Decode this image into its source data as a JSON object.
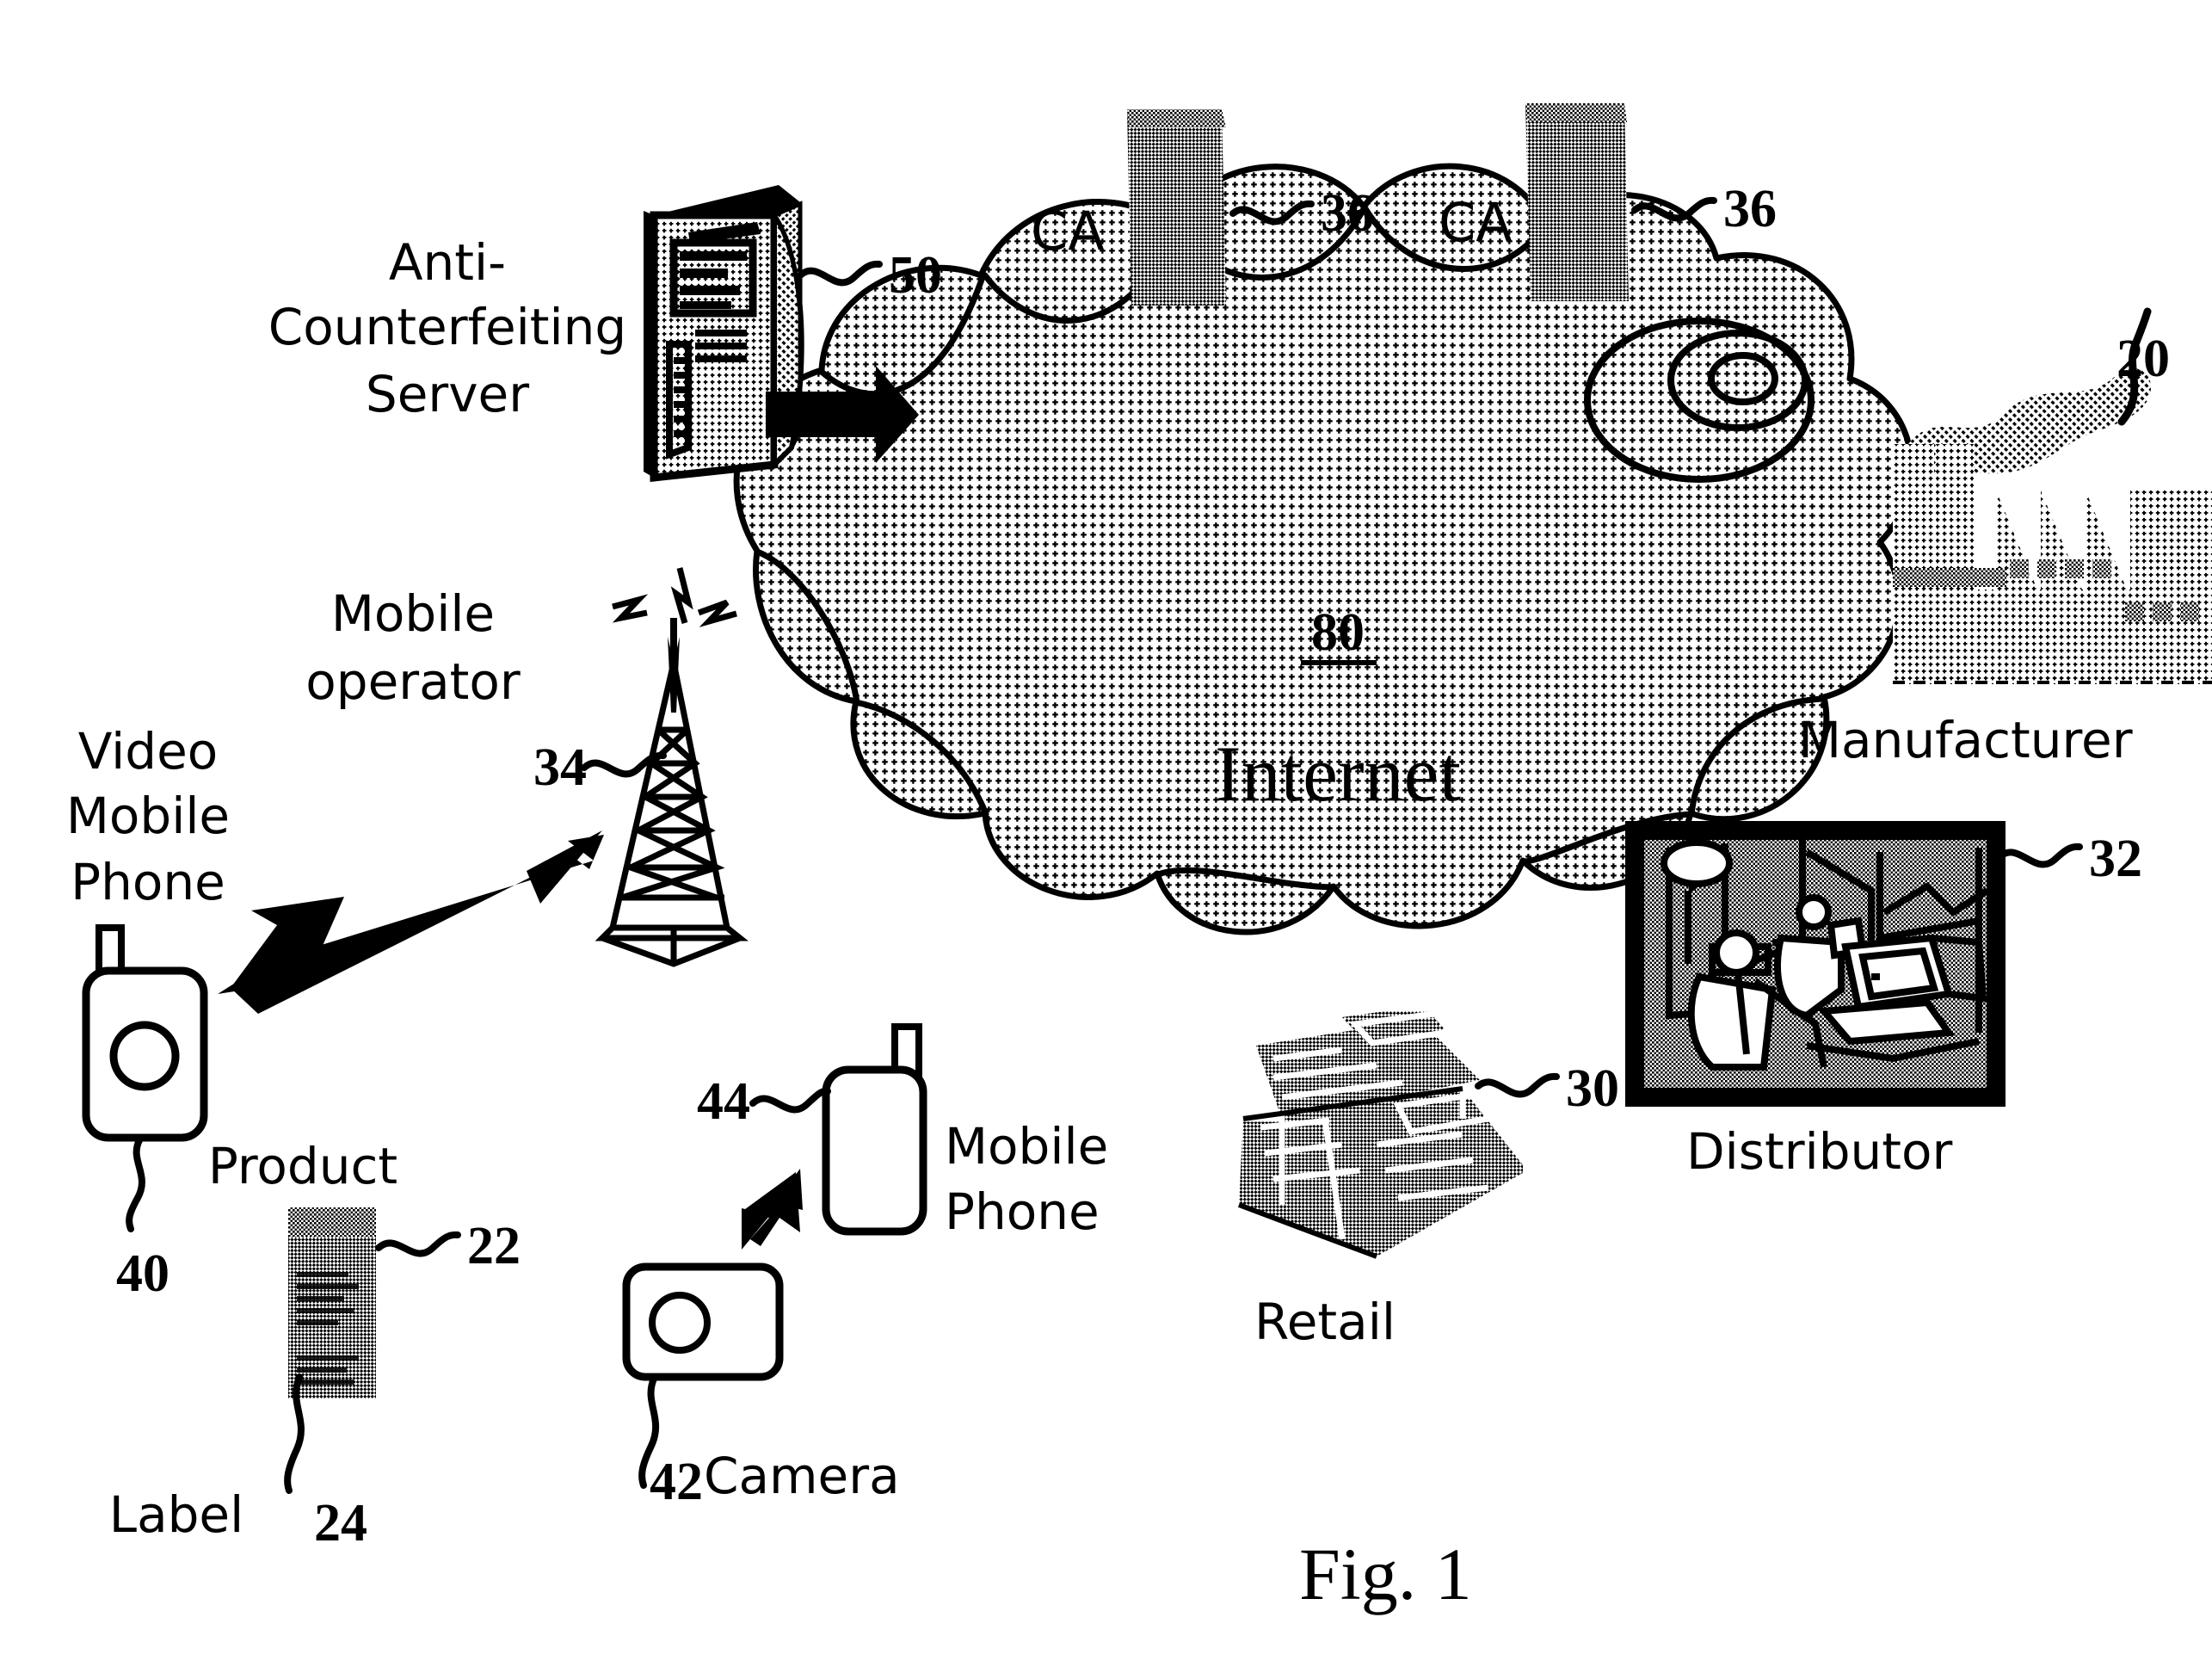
{
  "figure": {
    "caption": "Fig. 1",
    "type": "patent-network-diagram"
  },
  "cloud": {
    "ref_number": "80",
    "label": "Internet"
  },
  "nodes": [
    {
      "id": "anti-counterfeiting-server",
      "label": "Anti-\nCounterfeiting\nServer",
      "label_lines": [
        "Anti-",
        "Counterfeiting",
        "Server"
      ],
      "ref_number": "50",
      "icon": "server-tower-icon"
    },
    {
      "id": "ca-left",
      "label": "CA",
      "ref_number": "36",
      "icon": "server-rack-icon"
    },
    {
      "id": "ca-right",
      "label": "CA",
      "ref_number": "36",
      "icon": "server-rack-icon"
    },
    {
      "id": "manufacturer",
      "label": "Manufacturer",
      "ref_number": "20",
      "icon": "factory-icon"
    },
    {
      "id": "distributor",
      "label": "Distributor",
      "ref_number": "32",
      "icon": "warehouse-photo-icon"
    },
    {
      "id": "retail",
      "label": "Retail",
      "ref_number": "30",
      "icon": "cash-register-icon"
    },
    {
      "id": "mobile-operator",
      "label": "Mobile\noperator",
      "label_lines": [
        "Mobile",
        "operator"
      ],
      "ref_number": "34",
      "icon": "radio-tower-icon"
    },
    {
      "id": "video-mobile-phone",
      "label": "Video\nMobile\nPhone",
      "label_lines": [
        "Video",
        "Mobile",
        "Phone"
      ],
      "ref_number": "40",
      "icon": "mobile-phone-camera-icon"
    },
    {
      "id": "product",
      "label": "Product",
      "ref_number": "22",
      "icon": "product-box-icon"
    },
    {
      "id": "label",
      "label": "Label",
      "ref_number": "24",
      "icon": "label-icon"
    },
    {
      "id": "mobile-phone",
      "label": "Mobile\nPhone",
      "label_lines": [
        "Mobile",
        "Phone"
      ],
      "ref_number": "44",
      "icon": "mobile-phone-icon"
    },
    {
      "id": "camera",
      "label": "Camera",
      "ref_number": "42",
      "icon": "camera-icon"
    }
  ],
  "labels": {
    "anti_line1": "Anti-",
    "anti_line2": "Counterfeiting",
    "anti_line3": "Server",
    "server_ref": "50",
    "ca_left": "CA",
    "ca_left_ref": "36",
    "ca_right": "CA",
    "ca_right_ref": "36",
    "internet_ref": "80",
    "internet": "Internet",
    "manufacturer_ref": "20",
    "manufacturer": "Manufacturer",
    "distributor_ref": "32",
    "distributor": "Distributor",
    "retail_ref": "30",
    "retail": "Retail",
    "mobile_op_line1": "Mobile",
    "mobile_op_line2": "operator",
    "mobile_op_ref": "34",
    "video_line1": "Video",
    "video_line2": "Mobile",
    "video_line3": "Phone",
    "video_ref": "40",
    "product": "Product",
    "product_ref": "22",
    "label_text": "Label",
    "label_ref": "24",
    "mobile_phone_line1": "Mobile",
    "mobile_phone_line2": "Phone",
    "mobile_phone_ref": "44",
    "camera": "Camera",
    "camera_ref": "42",
    "figure_caption": "Fig. 1"
  },
  "connections": [
    {
      "from": "anti-counterfeiting-server",
      "to": "cloud",
      "style": "solid-arrow"
    },
    {
      "from": "ca-left",
      "to": "cloud",
      "style": "attached"
    },
    {
      "from": "ca-right",
      "to": "cloud",
      "style": "attached"
    },
    {
      "from": "manufacturer",
      "to": "cloud",
      "style": "attached"
    },
    {
      "from": "distributor",
      "to": "cloud",
      "style": "attached"
    },
    {
      "from": "retail",
      "to": "cloud",
      "style": "attached"
    },
    {
      "from": "mobile-operator",
      "to": "cloud",
      "style": "attached"
    },
    {
      "from": "video-mobile-phone",
      "to": "mobile-operator",
      "style": "double-arrow"
    },
    {
      "from": "mobile-phone",
      "to": "mobile-operator",
      "style": "double-arrow"
    },
    {
      "from": "camera",
      "to": "mobile-phone",
      "style": "double-arrow"
    }
  ],
  "colors": {
    "ink": "#000000",
    "paper": "#ffffff",
    "stipple": "#000000"
  }
}
